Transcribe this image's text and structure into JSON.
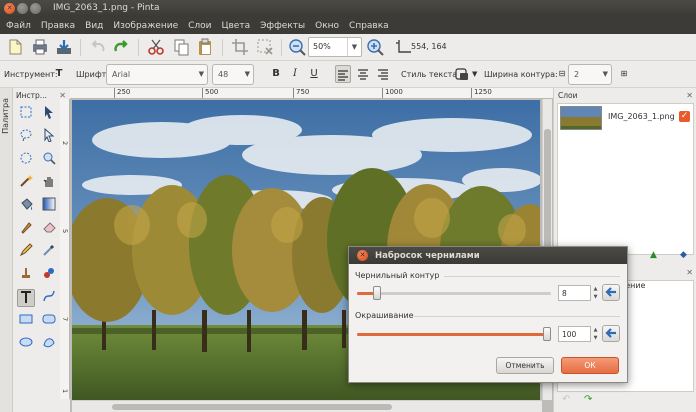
{
  "window": {
    "title": "IMG_2063_1.png - Pinta"
  },
  "menu": [
    "Файл",
    "Правка",
    "Вид",
    "Изображение",
    "Слои",
    "Цвета",
    "Эффекты",
    "Окно",
    "Справка"
  ],
  "toolbar": {
    "zoom_value": "50%",
    "coords": "554, 164"
  },
  "text_toolbar": {
    "tool_label": "Инструмент:",
    "font_label": "Шрифт:",
    "font_value": "Arial",
    "size_value": "48",
    "bold": "B",
    "italic": "I",
    "underline": "U",
    "text_style_label": "Стиль текста",
    "outline_width_label": "Ширина контура:",
    "outline_width_value": "2"
  },
  "tools_panel": {
    "palette_label": "Палитра",
    "header": "Инстр..."
  },
  "ruler": {
    "top": [
      "250",
      "500",
      "750",
      "1000",
      "1250"
    ],
    "left": [
      "2",
      "5",
      "7",
      "1"
    ]
  },
  "layers_panel": {
    "header": "Слои",
    "layers": [
      {
        "name": "IMG_2063_1.png",
        "visible": true
      }
    ]
  },
  "history_panel": {
    "header": "жение"
  },
  "dialog": {
    "title": "Набросок чернилами",
    "ink_outline_label": "Чернильный контур",
    "ink_outline_value": "8",
    "coloring_label": "Окрашивание",
    "coloring_value": "100",
    "cancel_label": "Отменить",
    "ok_label": "ОК"
  },
  "colors": {
    "accent": "#e56d41",
    "titlebar": "#3c3b37"
  }
}
